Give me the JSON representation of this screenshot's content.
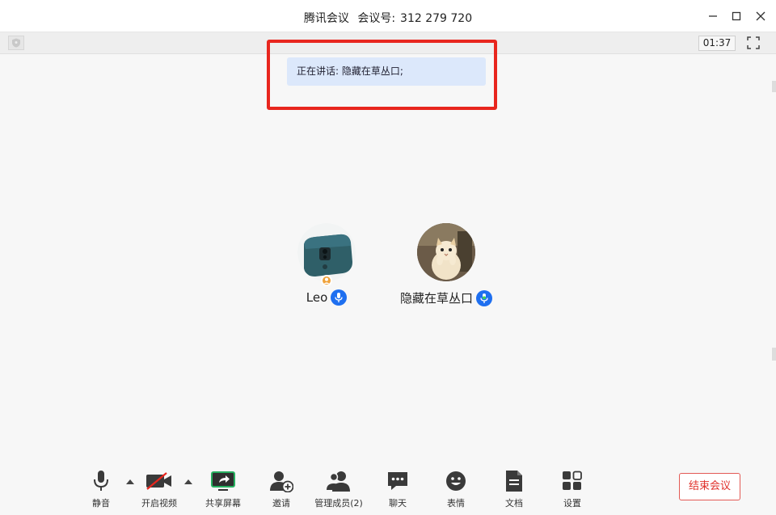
{
  "window": {
    "title_app": "腾讯会议",
    "title_meeting_label": "会议号:",
    "title_meeting_id": "312 279 720"
  },
  "strip": {
    "timer": "01:37"
  },
  "banner": {
    "speaking_text": "正在讲话: 隐藏在草丛口;"
  },
  "participants": [
    {
      "name": "Leo",
      "avatar_icon": "phone-photo-avatar",
      "is_host": true,
      "mic": "on"
    },
    {
      "name": "隐藏在草丛口",
      "avatar_icon": "cat-photo-avatar",
      "is_host": false,
      "mic": "speaking"
    }
  ],
  "toolbar": {
    "mute": "静音",
    "video": "开启视频",
    "share": "共享屏幕",
    "invite": "邀请",
    "members": "管理成员(2)",
    "chat": "聊天",
    "emoji": "表情",
    "docs": "文档",
    "settings": "设置",
    "end": "结束会议"
  },
  "colors": {
    "accent_blue": "#1e6ff0",
    "highlight_red": "#e8261e",
    "end_red": "#e0312b",
    "share_green": "#27b060"
  }
}
